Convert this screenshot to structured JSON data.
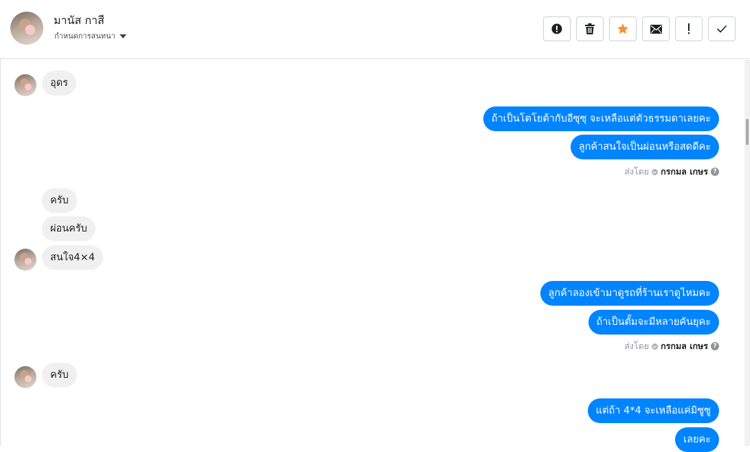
{
  "header": {
    "contact_name": "มานัส กาสี",
    "assign_label": "กำหนดการสนทนา",
    "actions": [
      {
        "name": "spam-button",
        "icon": "alert-circle-icon"
      },
      {
        "name": "delete-button",
        "icon": "trash-icon"
      },
      {
        "name": "star-button",
        "icon": "star-icon",
        "color": "#f7923a"
      },
      {
        "name": "mark-unread-button",
        "icon": "envelope-icon"
      },
      {
        "name": "follow-up-button",
        "icon": "exclamation-icon"
      },
      {
        "name": "mark-done-button",
        "icon": "check-icon"
      }
    ]
  },
  "colors": {
    "outgoing_bubble": "#0084ff",
    "incoming_bubble": "#f0f0f0"
  },
  "messages": {
    "m1": "อุดร",
    "m2": "ถ้าเป็นโตโยต้ากับอีซุซุ จะเหลือแต่ตัวธรรมดาเลยคะ",
    "m3": "ลูกค้าสนใจเป็นผ่อนหรือสดดีคะ",
    "m4": "ครับ",
    "m5": "ผ่อนครับ",
    "m6": "สนใจ4×4",
    "m7": "ลูกค้าลองเข้ามาดูรถที่ร้านเราดูไหมคะ",
    "m8": "ถ้าเป็นตั้มจะมีหลายคันยุคะ",
    "m9": "ครับ",
    "m10": "แต่ถ้า 4*4 จะเหลือแค่มิซูซู",
    "m11": "เลยคะ"
  },
  "sent_by": {
    "label": "ส่งโดย",
    "agent": "กรกมล เกษร",
    "help": "?"
  }
}
